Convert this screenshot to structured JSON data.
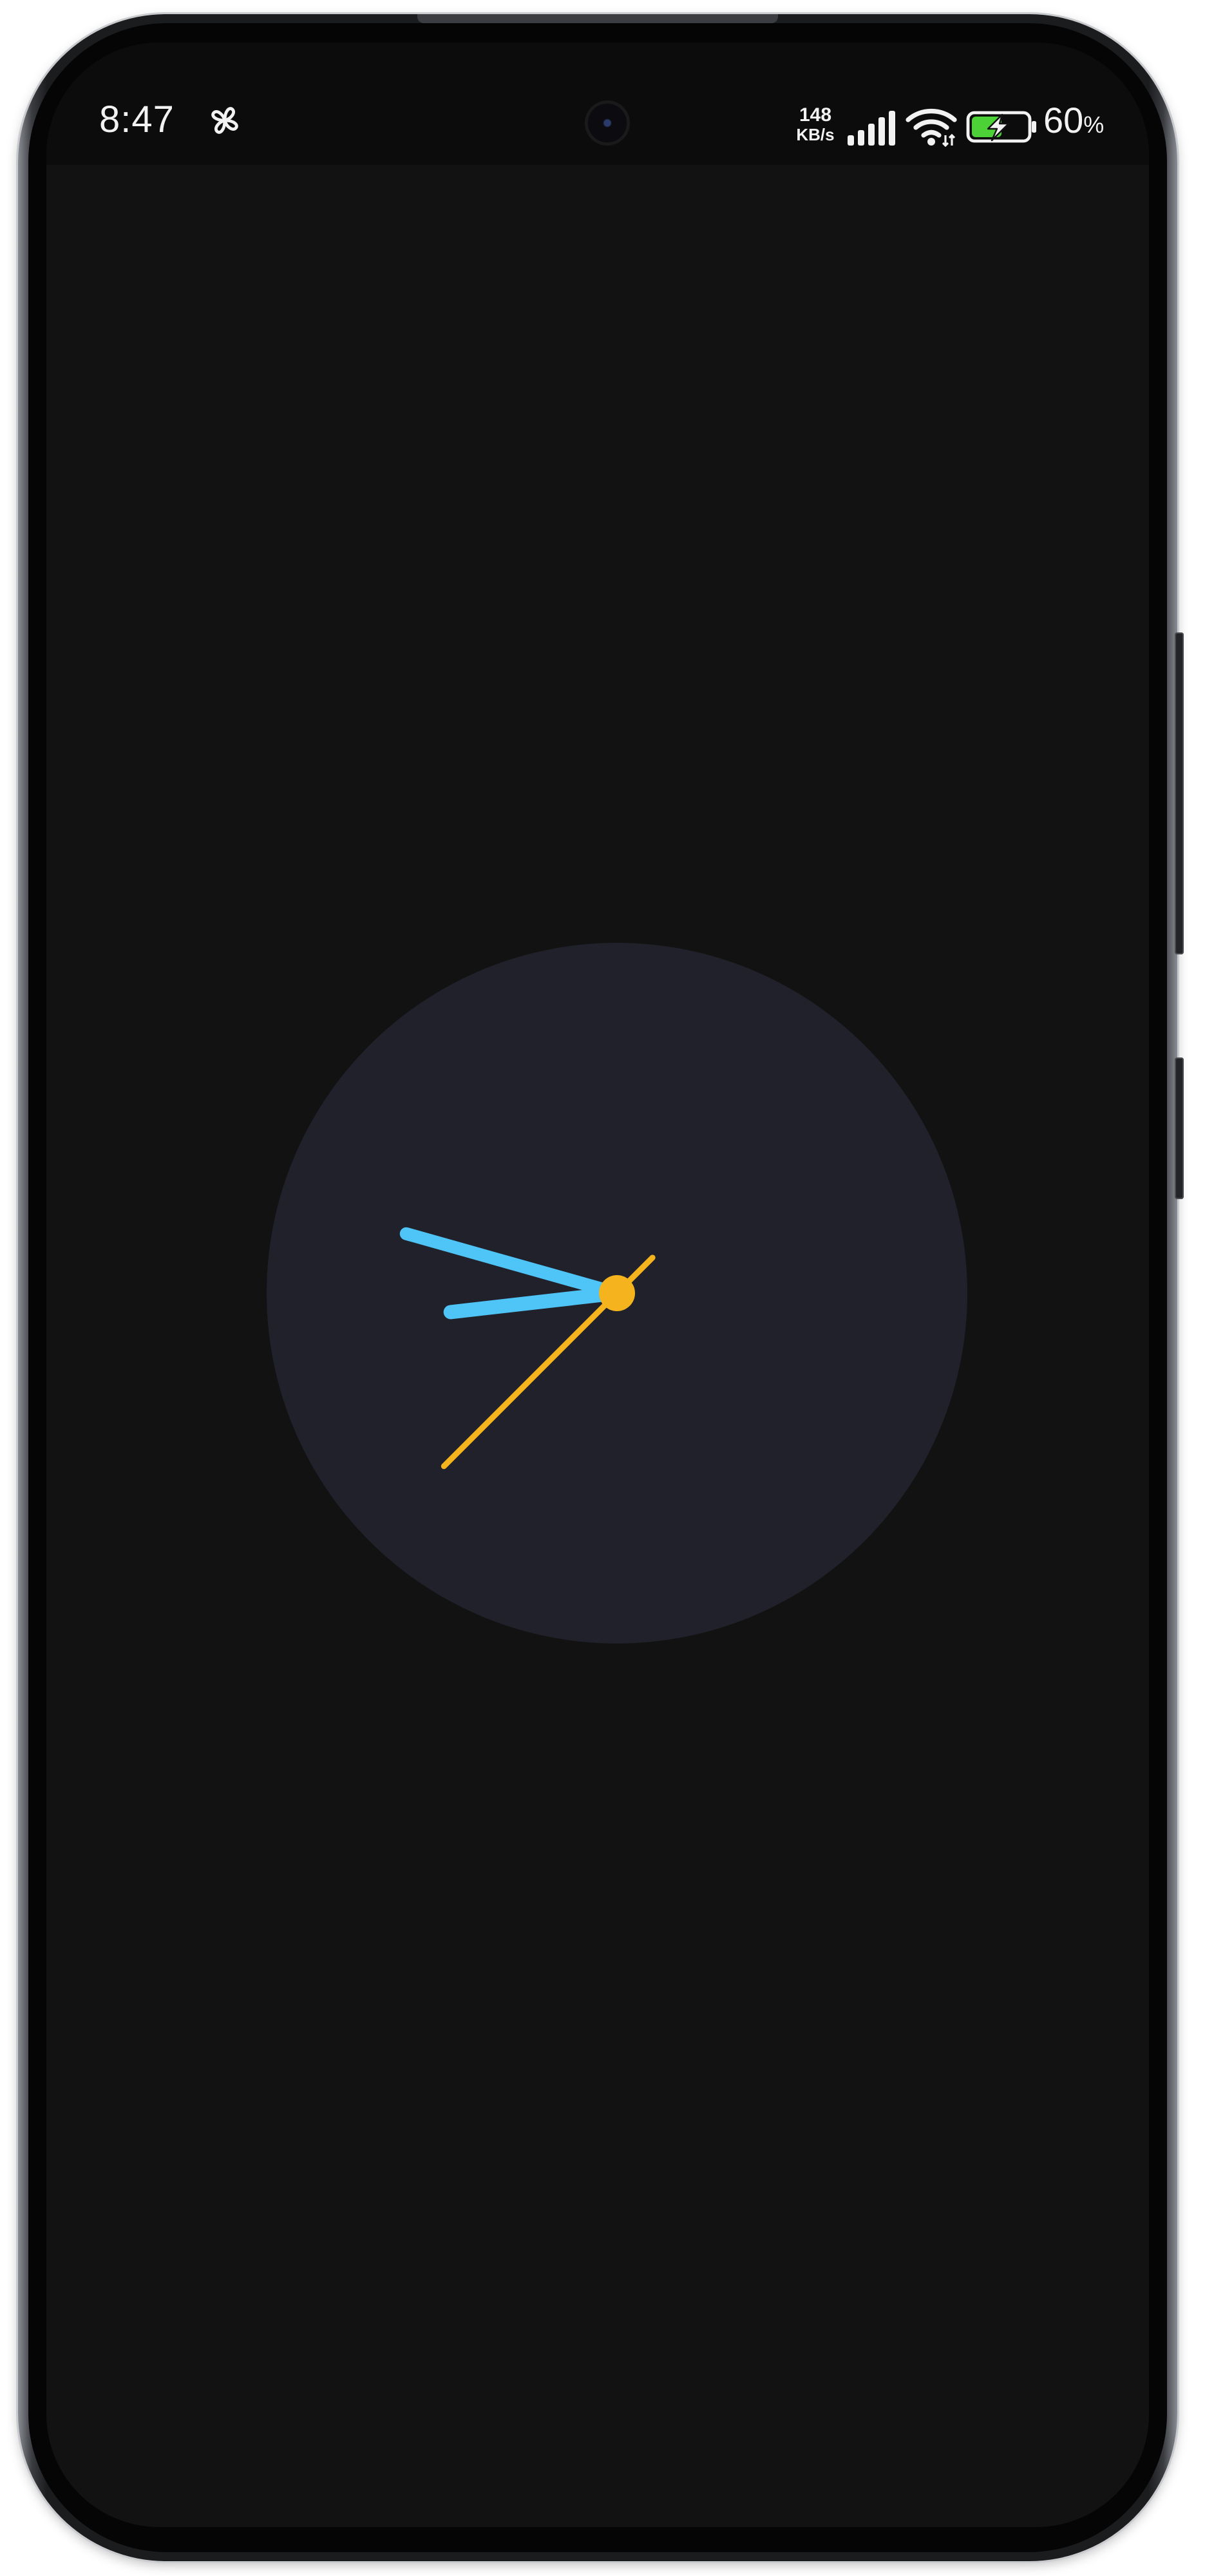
{
  "status_bar": {
    "time": "8:47",
    "notification_icon": "fan-icon",
    "network_speed_value": "148",
    "network_speed_unit": "KB/s",
    "signal_icon": "cellular-signal-icon",
    "wifi_icon": "wifi-icon",
    "battery_icon": "battery-charging-icon",
    "battery_level": "60",
    "battery_unit": "%"
  },
  "clock": {
    "type": "analog",
    "hour": 8,
    "minute": 47,
    "second": 37.5,
    "colors": {
      "face": "#20212a",
      "hour_hand": "#4ec4f7",
      "minute_hand": "#4ec4f7",
      "second_hand": "#f5b41e",
      "center_dot": "#f5b41e"
    }
  },
  "colors": {
    "screen_background": "#121212",
    "status_bar_background": "#0c0c0c",
    "battery_charge": "#4cd137",
    "status_text": "#f2f2f2"
  }
}
